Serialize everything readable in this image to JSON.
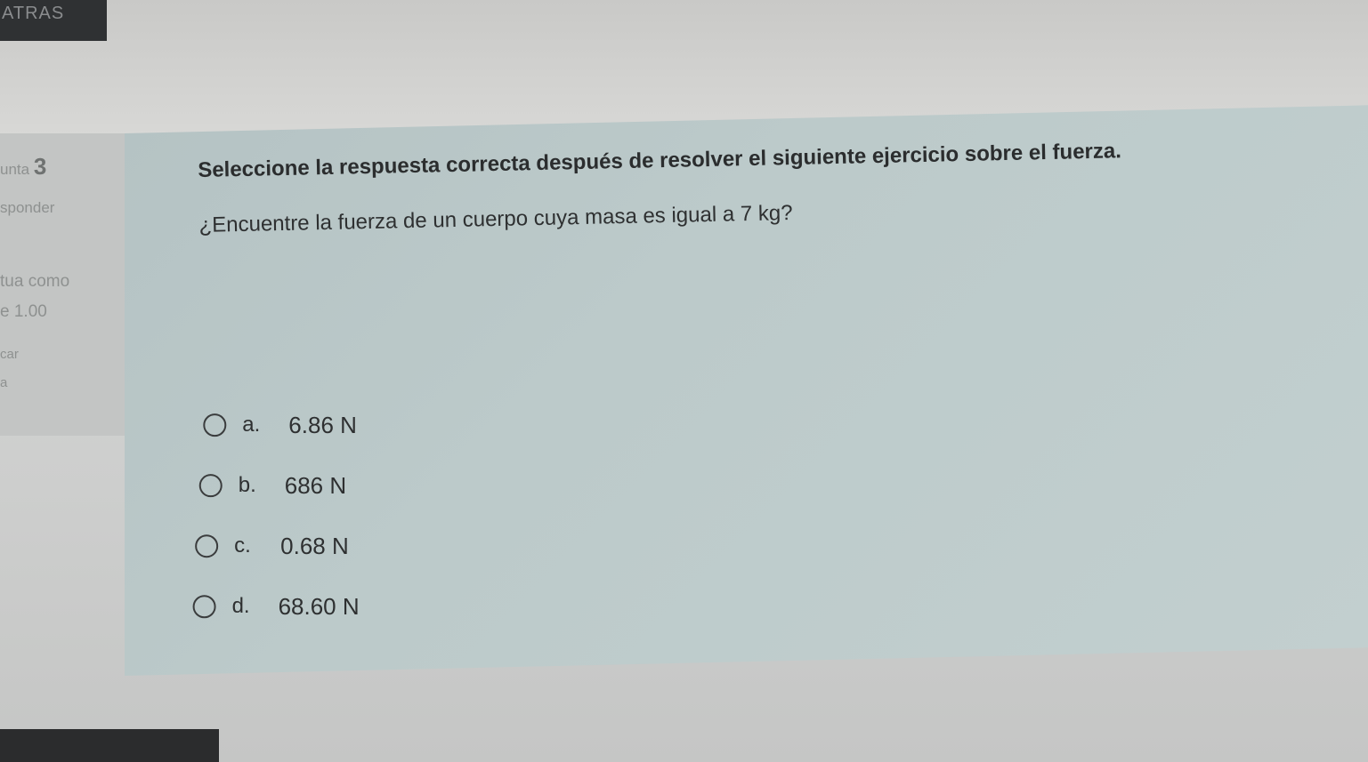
{
  "nav": {
    "back_label": "ATRAS"
  },
  "sidebar": {
    "question_prefix": "unta",
    "question_number": "3",
    "status": "sponder",
    "grade_label": "tua como",
    "grade_value": "e 1.00",
    "flag_label": "car",
    "flag_sub": "a"
  },
  "question": {
    "instruction": "Seleccione la respuesta correcta después de resolver el siguiente ejercicio sobre el fuerza.",
    "text": "¿Encuentre la fuerza de un cuerpo cuya masa es igual a 7 kg?",
    "options": [
      {
        "letter": "a.",
        "value": "6.86 N"
      },
      {
        "letter": "b.",
        "value": "686 N"
      },
      {
        "letter": "c.",
        "value": "0.68 N"
      },
      {
        "letter": "d.",
        "value": "68.60 N"
      }
    ]
  }
}
